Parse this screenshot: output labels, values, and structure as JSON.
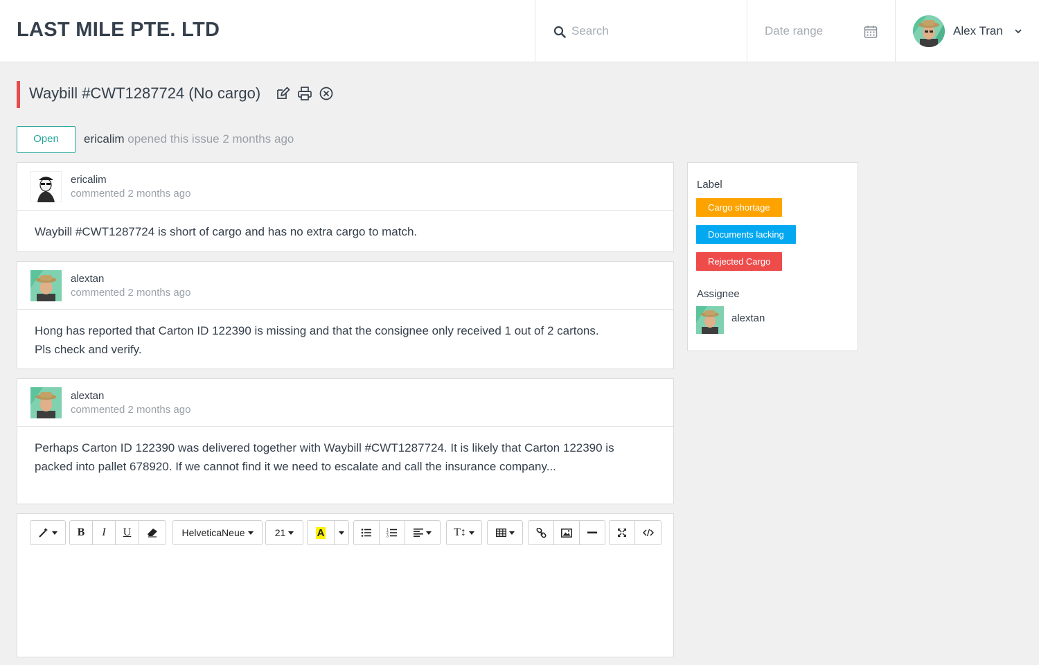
{
  "header": {
    "brand": "LAST MILE PTE. LTD",
    "search_placeholder": "Search",
    "date_range_placeholder": "Date range",
    "user_name": "Alex Tran"
  },
  "issue": {
    "title": "Waybill #CWT1287724 (No cargo)",
    "status": "Open",
    "opened_by": "ericalim",
    "opened_text": "opened this issue 2 months ago"
  },
  "comments": [
    {
      "author": "ericalim",
      "time": "commented 2 months ago",
      "body": "Waybill #CWT1287724 is short of cargo and has no extra cargo to match."
    },
    {
      "author": "alextan",
      "time": "commented 2 months ago",
      "body_lines": [
        "Hong has reported that Carton ID 122390 is missing and that the consignee only received 1 out of 2 cartons.",
        "Pls check and verify."
      ]
    },
    {
      "author": "alextan",
      "time": "commented 2 months ago",
      "body_lines": [
        "Perhaps Carton ID 122390 was delivered together with Waybill #CWT1287724. It is likely that Carton 122390 is",
        "packed into pallet 678920. If we cannot find it we need to escalate and call the insurance company..."
      ]
    }
  ],
  "editor": {
    "font_family": "HelveticaNeue",
    "font_size": "21",
    "bold": "B",
    "italic": "I",
    "underline": "U",
    "text_color_glyph": "A",
    "line_height_glyph": "T↕"
  },
  "sidebar": {
    "label_heading": "Label",
    "labels": [
      {
        "text": "Cargo shortage",
        "color": "#fda300"
      },
      {
        "text": "Documents lacking",
        "color": "#03a8f1"
      },
      {
        "text": "Rejected Cargo",
        "color": "#ed4c4b"
      }
    ],
    "assignee_heading": "Assignee",
    "assignee": "alextan"
  },
  "colors": {
    "accent_red": "#e74c4c",
    "status_teal": "#26a69a",
    "highlight_yellow": "#fff200"
  }
}
